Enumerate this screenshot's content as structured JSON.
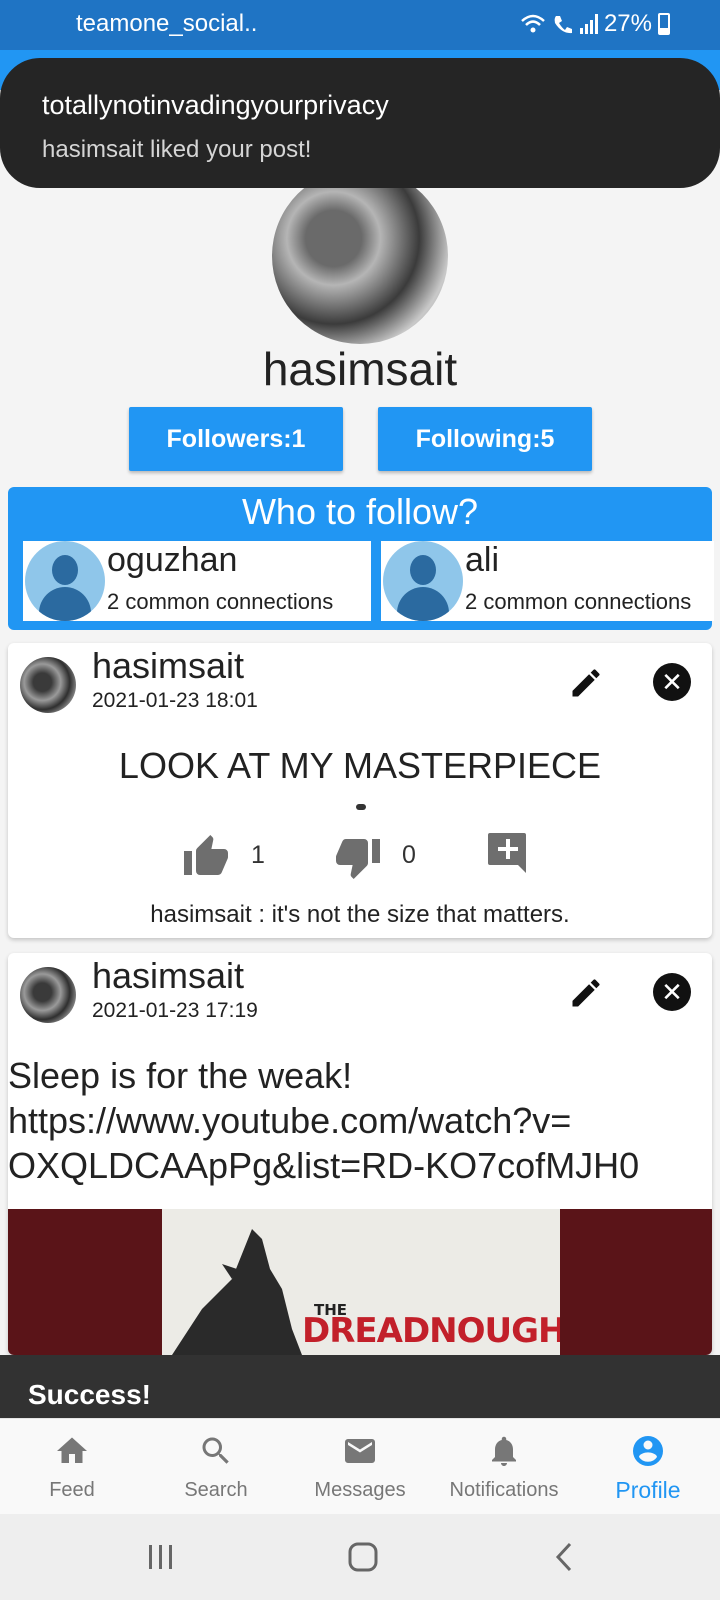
{
  "status_bar": {
    "app": "teamone_social..",
    "battery": "27%"
  },
  "toast": {
    "title": "totallynotinvadingyourprivacy",
    "message": "hasimsait liked your post!"
  },
  "profile": {
    "username": "hasimsait",
    "followers": "Followers:1",
    "following": "Following:5"
  },
  "who_to_follow": {
    "title": "Who to follow?",
    "items": [
      {
        "name": "oguzhan",
        "common": "2 common connections"
      },
      {
        "name": "ali",
        "common": "2 common connections"
      }
    ]
  },
  "posts": [
    {
      "author": "hasimsait",
      "date": "2021-01-23 18:01",
      "text": "LOOK AT MY MASTERPIECE",
      "likes": "1",
      "dislikes": "0",
      "comment": "hasimsait : it's not the size that matters."
    },
    {
      "author": "hasimsait",
      "date": "2021-01-23 17:19",
      "text_lines": [
        "Sleep is for the weak!",
        "https://www.youtube.com/watch?v=",
        "OXQLDCAApPg&list=RD-KO7cofMJH0"
      ],
      "thumbnail": {
        "small": "THE",
        "big": "DREADNOUGHTS"
      }
    }
  ],
  "snackbar": {
    "text": "Success!"
  },
  "nav": {
    "items": [
      {
        "label": "Feed",
        "icon": "home-icon"
      },
      {
        "label": "Search",
        "icon": "search-icon"
      },
      {
        "label": "Messages",
        "icon": "mail-icon"
      },
      {
        "label": "Notifications",
        "icon": "bell-icon"
      },
      {
        "label": "Profile",
        "icon": "account-circle-icon"
      }
    ],
    "active": "Profile"
  },
  "colors": {
    "primary": "#2196f3",
    "statusbar": "#1f74c4",
    "toast_bg": "#252525",
    "snackbar_bg": "#323232",
    "thumb_bg": "#5a1418",
    "thumb_text": "#c2202a"
  }
}
